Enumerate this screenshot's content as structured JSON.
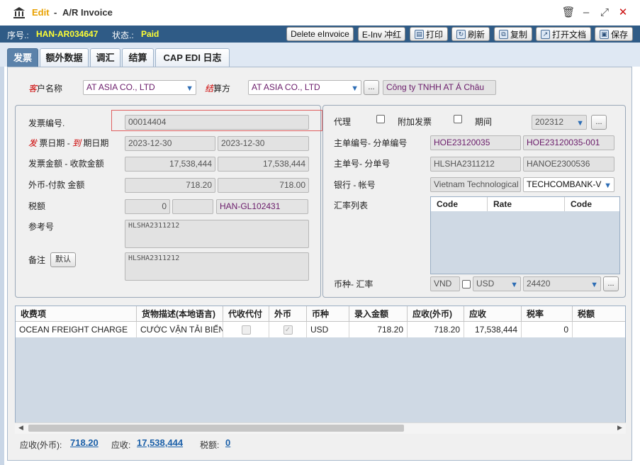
{
  "window": {
    "mode": "Edit",
    "separator": "-",
    "title": "A/R Invoice",
    "controls": {
      "delete": "🗑",
      "minimize": "–",
      "restore": "⤢",
      "close": "✕"
    }
  },
  "info": {
    "seq_label": "序号.:",
    "seq_value": "HAN-AR034647",
    "status_label": "状态.:",
    "status_value": "Paid"
  },
  "toolbar": {
    "delete_einvoice": "Delete eInvoice",
    "einv_reverse": "E-Inv 冲红",
    "print": "打印",
    "refresh": "刷新",
    "copy": "复制",
    "open_docs": "打开文档",
    "save": "保存"
  },
  "tabs": [
    "发票",
    "额外数据",
    "调汇",
    "结算",
    "CAP EDI 日志"
  ],
  "customer": {
    "label_red": "客",
    "label_rest": "户名称",
    "value": "AT ASIA CO., LTD",
    "settle_label_red": "结",
    "settle_label_rest": "算方",
    "settle_value": "AT ASIA CO., LTD",
    "more": "...",
    "local_name": "Công ty TNHH AT Á Châu"
  },
  "left": {
    "invoice_no_label": "发票编号.",
    "invoice_no": "00014404",
    "date_label_red1": "发",
    "date_label_mid": "票日期 -",
    "date_label_red2": "到",
    "date_label_end": "期日期",
    "invoice_date": "2023-12-30",
    "due_date": "2023-12-30",
    "amount_label": "发票金额 - 收款金额",
    "invoice_amount": "17,538,444",
    "received_amount": "17,538,444",
    "fx_label": "外币-付款 金额",
    "fx_amount": "718.20",
    "fx_paid": "718.00",
    "tax_label": "税额",
    "tax_value": "0",
    "tax_extra": "",
    "gl_no": "HAN-GL102431",
    "ref_label": "参考号",
    "ref_value": "HLSHA2311212",
    "remark_label": "备注",
    "default_button": "默认",
    "remark_value": "HLSHA2311212"
  },
  "right": {
    "agent_label": "代理",
    "attach_label": "附加发票",
    "period_label": "期间",
    "period_value": "202312",
    "more": "...",
    "master_label": "主单编号- 分单编号",
    "master_no": "HOE23120035",
    "house_no": "HOE23120035-001",
    "mbl_label": "主单号- 分单号",
    "mbl_no": "HLSHA2311212",
    "hbl_no": "HANOE2300536",
    "bank_label": "银行 - 帐号",
    "bank_name": "Vietnam Technological",
    "bank_account": "TECHCOMBANK-V",
    "rate_list_label": "汇率列表",
    "rate_headers": [
      "Code",
      "Rate",
      "Code"
    ],
    "currency_label": "币种- 汇率",
    "currency_base": "VND",
    "currency_fx": "USD",
    "rate_value": "24420"
  },
  "grid": {
    "headers": [
      "收费项",
      "货物描述(本地语言)",
      "代收代付",
      "外币",
      "币种",
      "录入金额",
      "应收(外币)",
      "应收",
      "税率",
      "税额"
    ],
    "rows": [
      {
        "charge": "OCEAN FREIGHT CHARGE",
        "desc": "CƯỚC VẬN TẢI BIỂN",
        "currency": "USD",
        "input_amount": "718.20",
        "receivable_fx": "718.20",
        "receivable": "17,538,444",
        "tax_rate": "0",
        "tax": ""
      }
    ]
  },
  "footer": {
    "fx_label": "应收(外币):",
    "fx_value": "718.20",
    "ar_label": "应收:",
    "ar_value": "17,538,444",
    "tax_label": "税额:",
    "tax_value": "0"
  },
  "colors": {
    "infobar": "#2f5b86",
    "status": "#ffff33",
    "active_tab": "#5b82aa",
    "link": "#1a5fa8"
  }
}
